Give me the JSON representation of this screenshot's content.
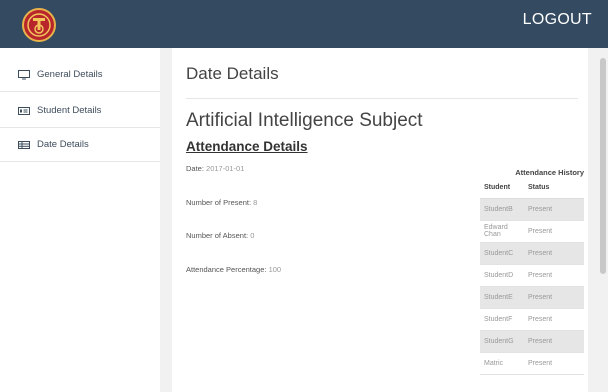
{
  "header": {
    "logout_label": "LOGOUT"
  },
  "sidebar": {
    "items": [
      {
        "label": "General Details",
        "icon": "monitor-icon"
      },
      {
        "label": "Student Details",
        "icon": "student-card-icon"
      },
      {
        "label": "Date Details",
        "icon": "table-icon"
      }
    ]
  },
  "main": {
    "page_title": "Date Details",
    "subject_title": "Artificial Intelligence Subject",
    "attendance_heading": "Attendance Details",
    "details": [
      {
        "label": "Date:",
        "value": "2017-01-01"
      },
      {
        "label": "Number of Present:",
        "value": "8"
      },
      {
        "label": "Number of Absent:",
        "value": "0"
      },
      {
        "label": "Attendance Percentage:",
        "value": "100"
      }
    ],
    "history": {
      "title": "Attendance History",
      "columns": [
        "Student",
        "Status"
      ],
      "rows": [
        [
          "StudentB",
          "Present"
        ],
        [
          "Edward Chan",
          "Present"
        ],
        [
          "StudentC",
          "Present"
        ],
        [
          "StudentD",
          "Present"
        ],
        [
          "StudentE",
          "Present"
        ],
        [
          "StudentF",
          "Present"
        ],
        [
          "StudentG",
          "Present"
        ],
        [
          "Matric",
          "Present"
        ]
      ]
    }
  },
  "colors": {
    "header_bg": "#334a61",
    "logo_red": "#b8262b",
    "logo_gold": "#e8b24a",
    "content_bg": "#f1f1f1"
  }
}
